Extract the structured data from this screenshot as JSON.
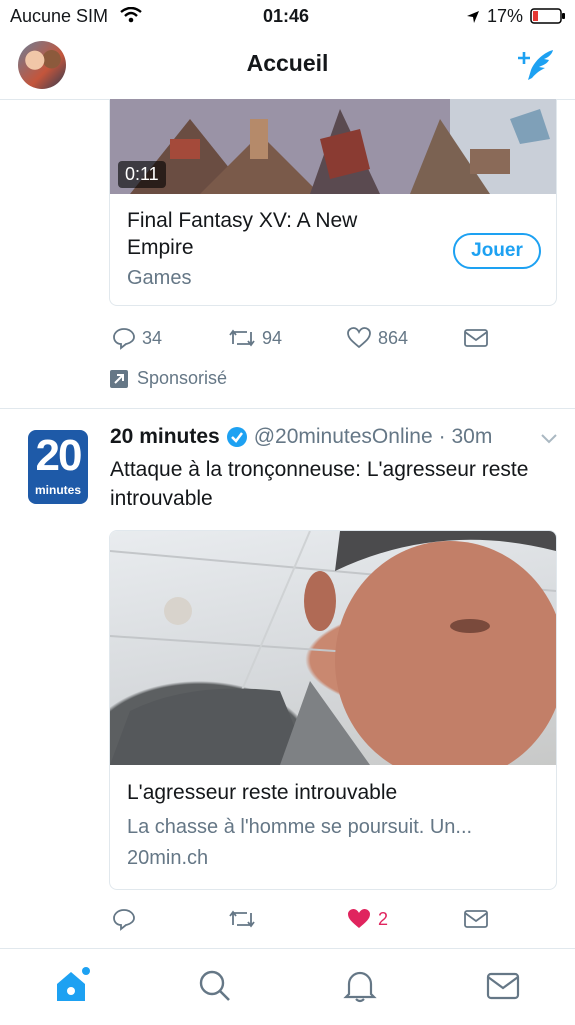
{
  "status_bar": {
    "carrier": "Aucune SIM",
    "time": "01:46",
    "battery": "17%"
  },
  "header": {
    "title": "Accueil"
  },
  "promoted_tweet": {
    "video_duration": "0:11",
    "card_title": "Final Fantasy XV: A New Empire",
    "card_category": "Games",
    "cta_label": "Jouer",
    "replies": "34",
    "retweets": "94",
    "likes": "864",
    "sponsored_label": "Sponsorisé"
  },
  "tweet": {
    "author_name": "20 minutes",
    "handle": "@20minutesOnline",
    "time": "· 30m",
    "logo_number": "20",
    "logo_text": "minutes",
    "text": "Attaque à la tronçonneuse: L'agresseur reste introuvable",
    "card_title": "L'agresseur reste introuvable",
    "card_description": "La chasse à l'homme se poursuit. Un...",
    "card_domain": "20min.ch",
    "likes": "2"
  },
  "colors": {
    "accent": "#1da1f2",
    "like_active": "#e0245e",
    "muted": "#657786"
  }
}
